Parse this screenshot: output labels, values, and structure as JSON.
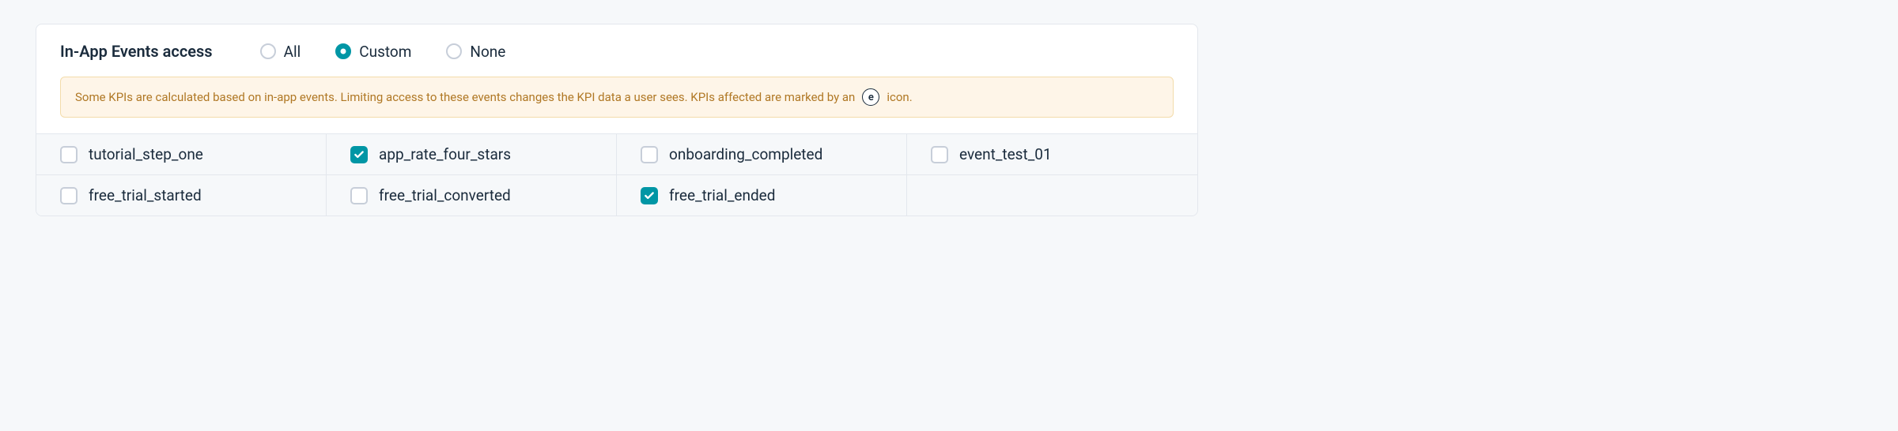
{
  "header": {
    "title": "In-App Events access",
    "radios": [
      {
        "label": "All",
        "selected": false
      },
      {
        "label": "Custom",
        "selected": true
      },
      {
        "label": "None",
        "selected": false
      }
    ]
  },
  "banner": {
    "text_before": "Some KPIs are calculated based on in-app events. Limiting access to these events changes the KPI data a user sees. KPIs affected are marked by an",
    "badge": "e",
    "text_after": "icon."
  },
  "events": [
    {
      "name": "tutorial_step_one",
      "checked": false
    },
    {
      "name": "app_rate_four_stars",
      "checked": true
    },
    {
      "name": "onboarding_completed",
      "checked": false
    },
    {
      "name": "event_test_01",
      "checked": false
    },
    {
      "name": "free_trial_started",
      "checked": false
    },
    {
      "name": "free_trial_converted",
      "checked": false
    },
    {
      "name": "free_trial_ended",
      "checked": true
    },
    {
      "name": "",
      "checked": false,
      "empty": true
    }
  ]
}
